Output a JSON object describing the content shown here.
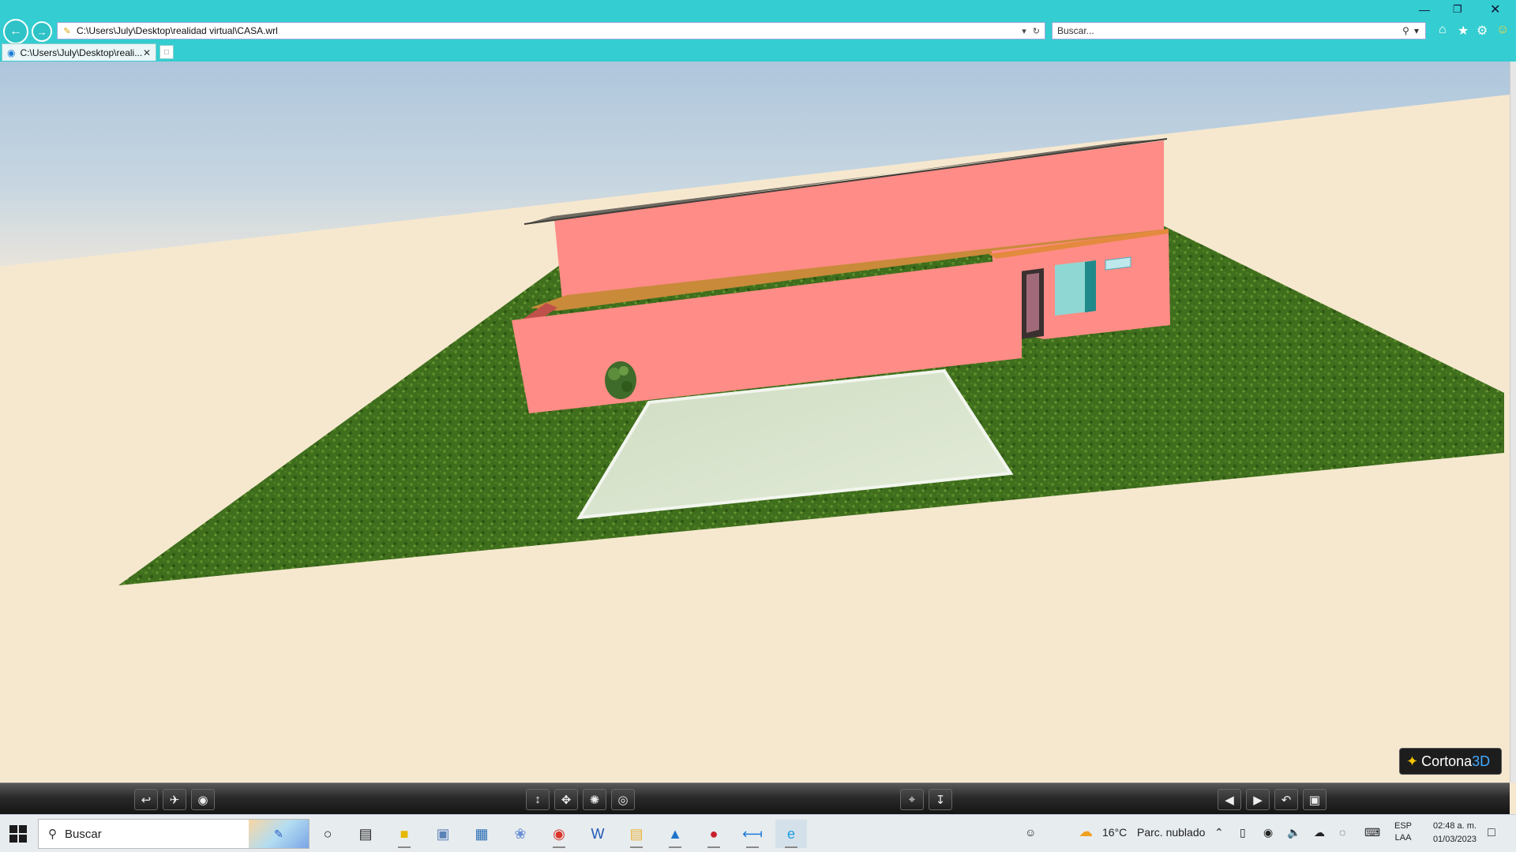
{
  "browser": {
    "address_url": "C:\\Users\\July\\Desktop\\realidad virtual\\CASA.wrl",
    "search_placeholder": "Buscar...",
    "tab_title": "C:\\Users\\July\\Desktop\\reali...",
    "icons": {
      "back": "back-arrow-icon",
      "forward": "forward-arrow-icon",
      "home": "home-icon",
      "favorites": "star-icon",
      "tools": "gear-icon",
      "feedback": "smiley-icon"
    }
  },
  "viewer": {
    "badge_brand": "Cortona",
    "badge_brand_3d": "3D",
    "colors": {
      "sky_top": "#b3c9de",
      "ground_plain": "#f6e8cf",
      "grass": "#3d6d1c",
      "house_wall": "#ff8c86",
      "roof": "#7a776f",
      "patio": "#dce8cf",
      "toolbar": "#2a2a2a"
    },
    "toolbar": {
      "left_buttons": [
        "walk-icon",
        "fly-icon",
        "study-icon"
      ],
      "center_buttons": [
        "plan-icon",
        "pan-icon",
        "turn-icon",
        "roll-icon"
      ],
      "right_buttons": [
        "goto-icon",
        "align-icon"
      ],
      "far_right_buttons": [
        "previous-viewpoint-icon",
        "next-viewpoint-icon",
        "restore-icon",
        "fit-icon"
      ]
    }
  },
  "taskbar": {
    "search_label": "Buscar",
    "weather_temp": "16°C",
    "weather_desc": "Parc. nublado",
    "lang_top": "ESP",
    "lang_bottom": "LAA",
    "time": "02:48 a. m.",
    "date": "01/03/2023",
    "apps": [
      "cortana-icon",
      "task-view-icon",
      "sticky-notes-icon",
      "image-viewer-icon",
      "calculator-icon",
      "feather-icon",
      "chrome-icon",
      "word-icon",
      "file-explorer-icon",
      "photos-icon",
      "b-app-icon",
      "vscode-icon",
      "internet-explorer-icon"
    ]
  }
}
